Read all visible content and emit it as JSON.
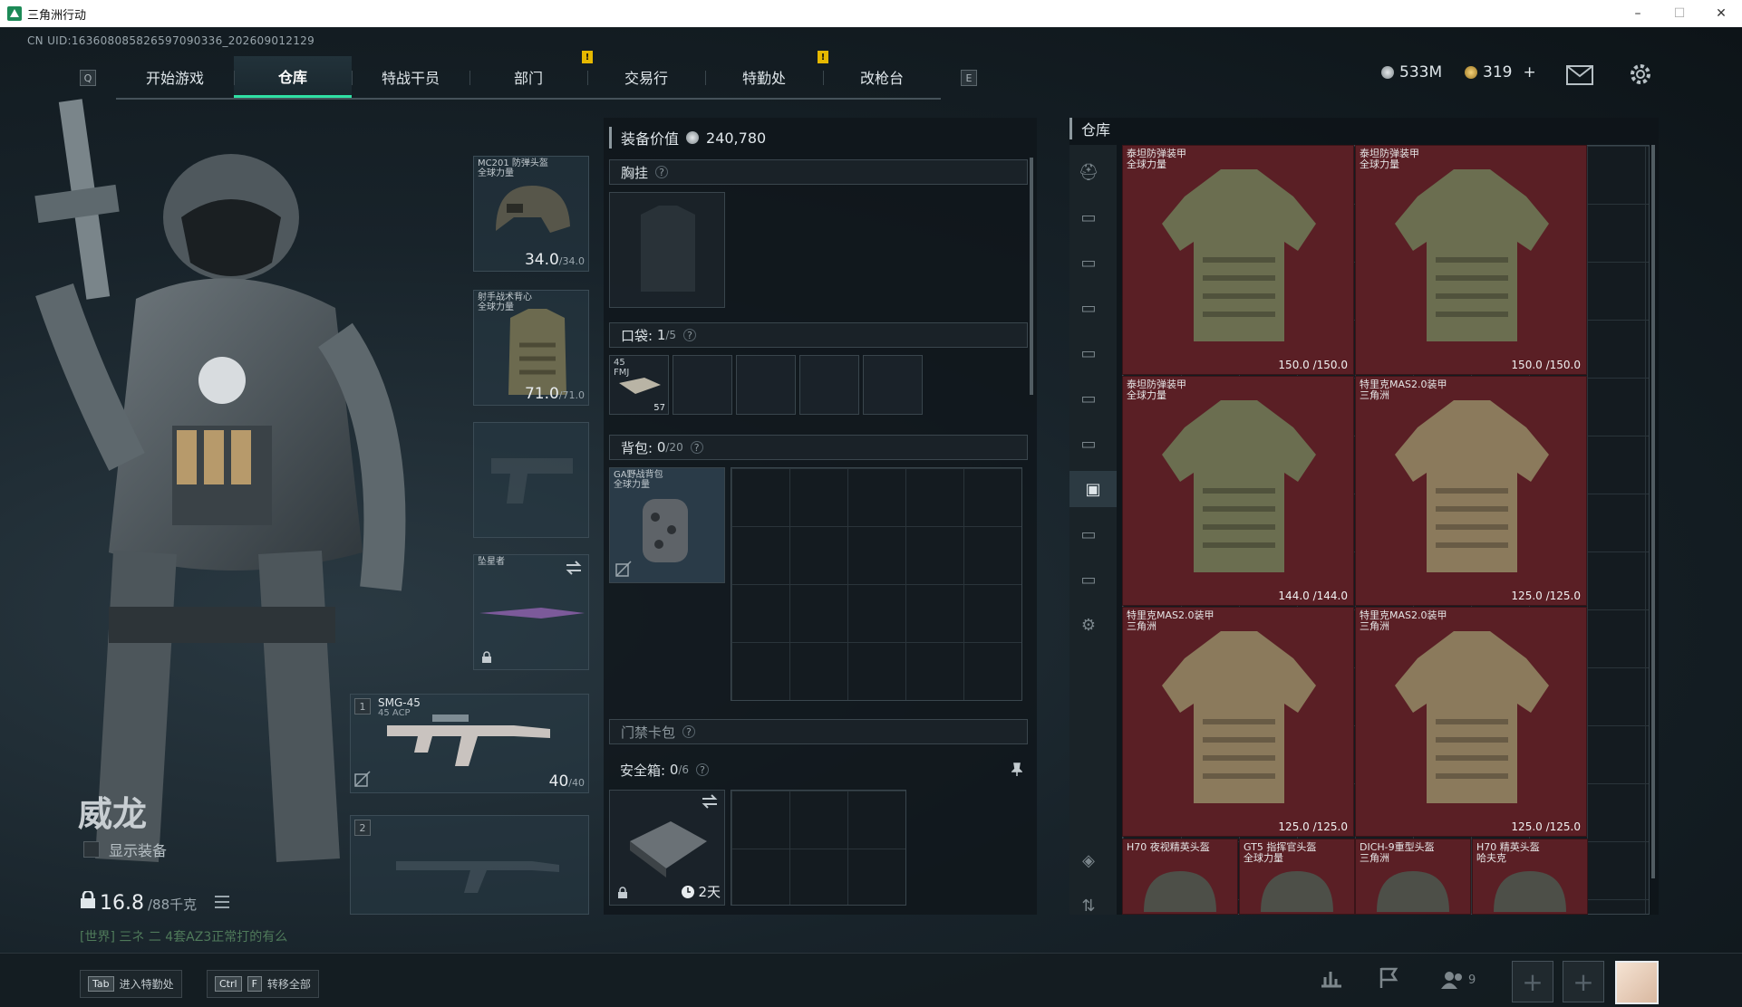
{
  "window": {
    "title": "三角洲行动",
    "minimize": "–",
    "maximize": "☐",
    "close": "✕"
  },
  "uid": "CN UID:163608085826597090336_202609012129",
  "tabs": [
    {
      "label": "开始游戏",
      "active": false
    },
    {
      "label": "仓库",
      "active": true
    },
    {
      "label": "特战干员",
      "active": false
    },
    {
      "label": "部门",
      "active": false
    },
    {
      "label": "交易行",
      "active": false
    },
    {
      "label": "特勤处",
      "active": false
    },
    {
      "label": "改枪台",
      "active": false
    }
  ],
  "keyhints": {
    "left": "Q",
    "right": "E"
  },
  "notif_mark": "!",
  "currency": {
    "silver": "533M",
    "gold": "319",
    "gold_add": "+"
  },
  "operator": {
    "name": "威龙",
    "show_equipment": "显示装备",
    "weight_value": "16.8",
    "weight_max": "/88千克",
    "chat": "[世界] 三ネ 二 4套AZ3正常打的有么"
  },
  "gear": {
    "helmet": {
      "name": "MC201 防弹头盔\n全球力量",
      "value": "34.0",
      "max": "/34.0"
    },
    "armor": {
      "name": "射手战术背心\n全球力量",
      "value": "71.0",
      "max": "/71.0"
    },
    "melee": {
      "name": "坠星者"
    },
    "primary": {
      "slot": "1",
      "name": "SMG-45",
      "sub": "45 ACP",
      "ammo": "40",
      "ammo_max": "/40"
    },
    "secondary": {
      "slot": "2"
    }
  },
  "loadout": {
    "value_label": "装备价值",
    "value": "240,780",
    "chest_label": "胸挂",
    "pocket_label": "口袋:",
    "pocket_count": "1",
    "pocket_max": "/5",
    "pocket_item": {
      "name": "45\nFMJ",
      "count": "57"
    },
    "backpack_label": "背包:",
    "backpack_count": "0",
    "backpack_max": "/20",
    "backpack_item": "GA野战背包\n全球力量",
    "keycard_label": "门禁卡包",
    "safebox_label": "安全箱:",
    "safebox_count": "0",
    "safebox_max": "/6",
    "safebox_time": "2天",
    "help": "?"
  },
  "stash": {
    "title": "仓库",
    "items": [
      {
        "name": "泰坦防弹装甲\n全球力量",
        "dur": "150.0 /150.0",
        "color": "#6b6e50"
      },
      {
        "name": "泰坦防弹装甲\n全球力量",
        "dur": "150.0 /150.0",
        "color": "#6b6e50"
      },
      {
        "name": "泰坦防弹装甲\n全球力量",
        "dur": "144.0 /144.0",
        "color": "#6b6e50"
      },
      {
        "name": "特里克MAS2.0装甲\n三角洲",
        "dur": "125.0 /125.0",
        "color": "#8b7a5c"
      },
      {
        "name": "特里克MAS2.0装甲\n三角洲",
        "dur": "125.0 /125.0",
        "color": "#8b7a5c"
      },
      {
        "name": "特里克MAS2.0装甲\n三角洲",
        "dur": "125.0 /125.0",
        "color": "#8b7a5c"
      }
    ],
    "helmets": [
      {
        "name": "H70 夜视精英头盔"
      },
      {
        "name": "GT5 指挥官头盔\n全球力量"
      },
      {
        "name": "DICH-9重型头盔\n三角洲"
      },
      {
        "name": "H70 精英头盔\n哈夫克"
      }
    ]
  },
  "bottom": {
    "tab_key": "Tab",
    "tab_label": "进入特勤处",
    "ctrl_key": "Ctrl",
    "f_key": "F",
    "transfer_label": "转移全部",
    "friends": "9"
  }
}
